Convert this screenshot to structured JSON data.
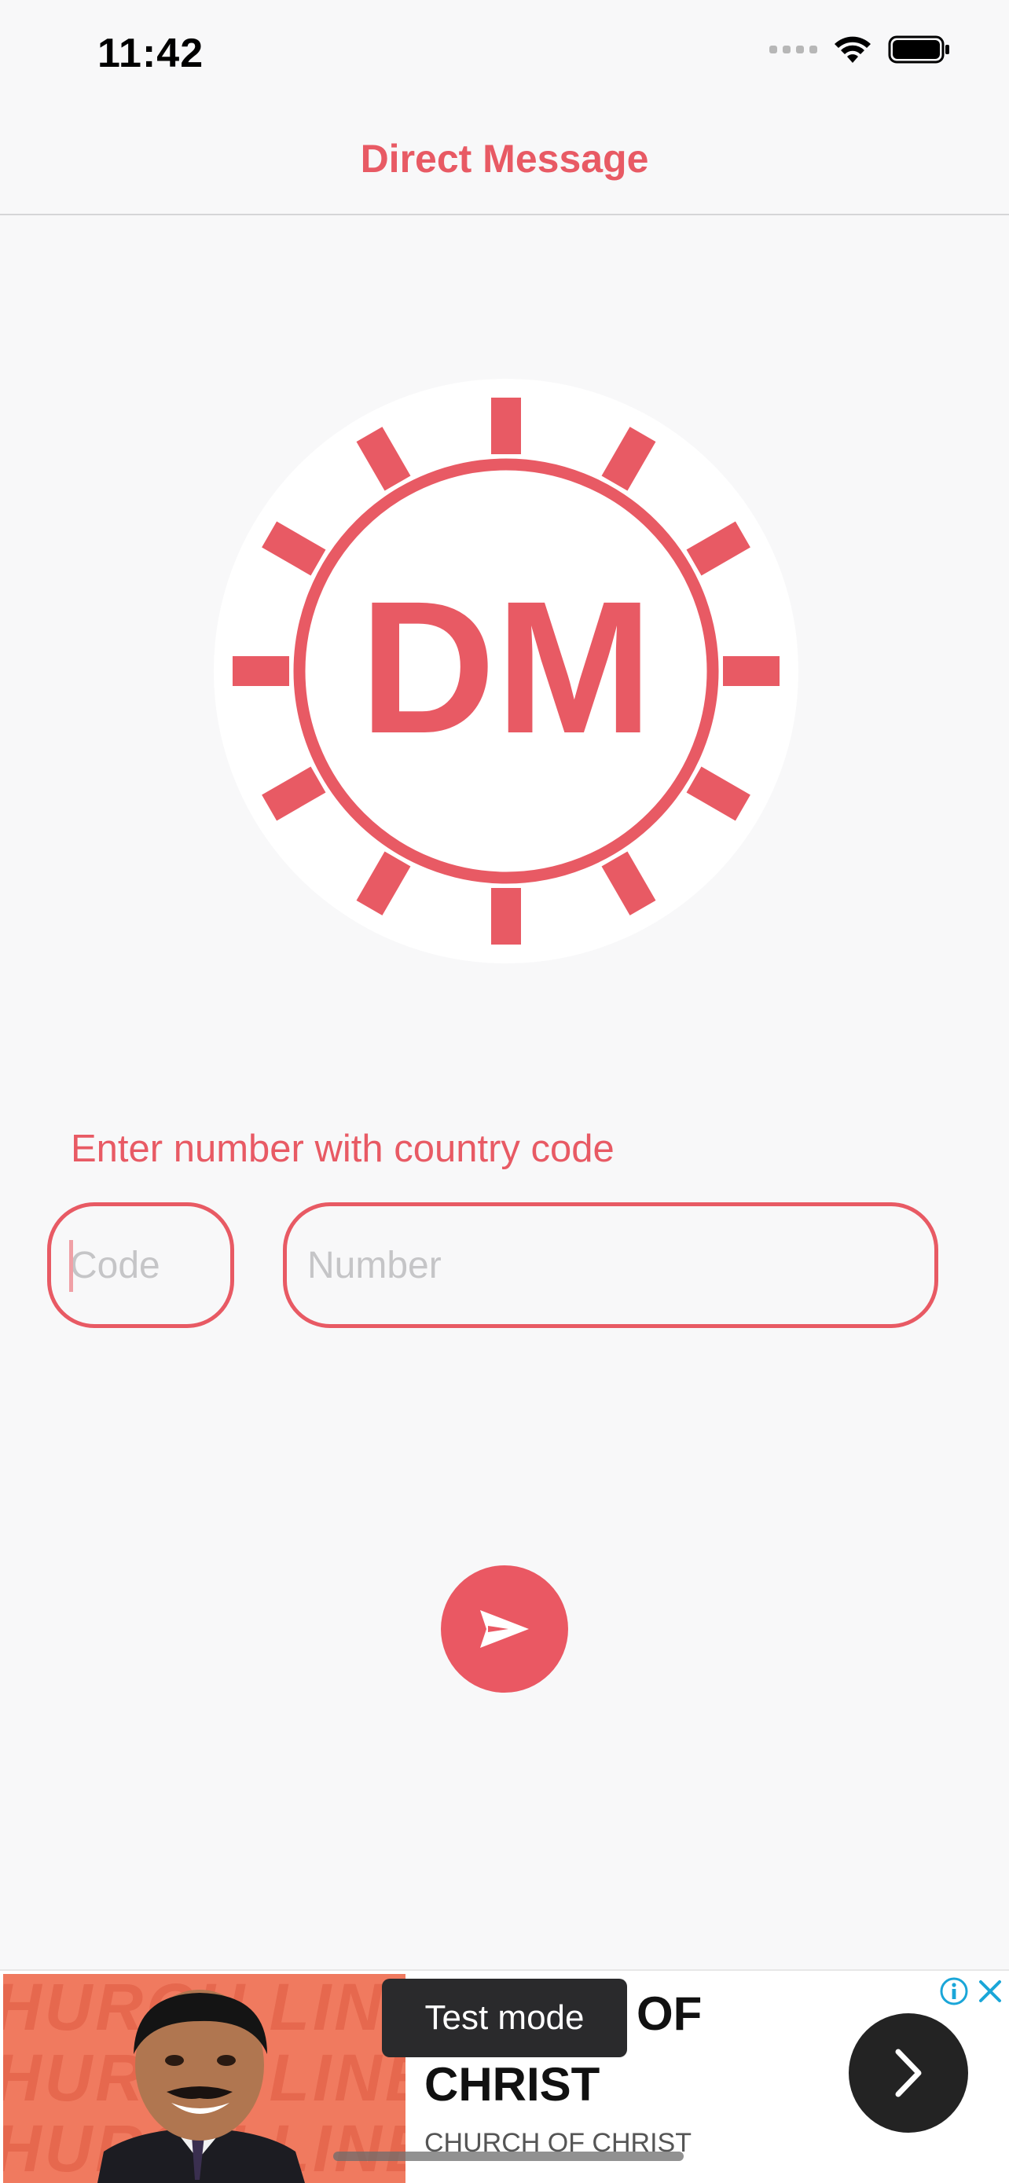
{
  "status_bar": {
    "time": "11:42",
    "icons": [
      "cellular-signal-icon",
      "wifi-icon",
      "battery-icon"
    ]
  },
  "nav": {
    "title": "Direct Message"
  },
  "logo": {
    "text": "DM"
  },
  "form": {
    "label": "Enter number with country code",
    "code_placeholder": "Code",
    "code_value": "",
    "number_placeholder": "Number",
    "number_value": ""
  },
  "send_button": {
    "icon": "send-icon"
  },
  "ad": {
    "test_mode_label": "Test mode",
    "headline_line1": "OF",
    "headline_line2": "CHRIST",
    "advertiser": "CHURCH OF CHRIST",
    "cta_icon": "chevron-right-icon",
    "info_icon": "adchoices-info-icon",
    "close_icon": "close-icon"
  },
  "colors": {
    "accent": "#e85a64",
    "background": "#f8f8f9",
    "ad_image_bg": "#f07a5f",
    "ad_cta_bg": "#232323"
  }
}
